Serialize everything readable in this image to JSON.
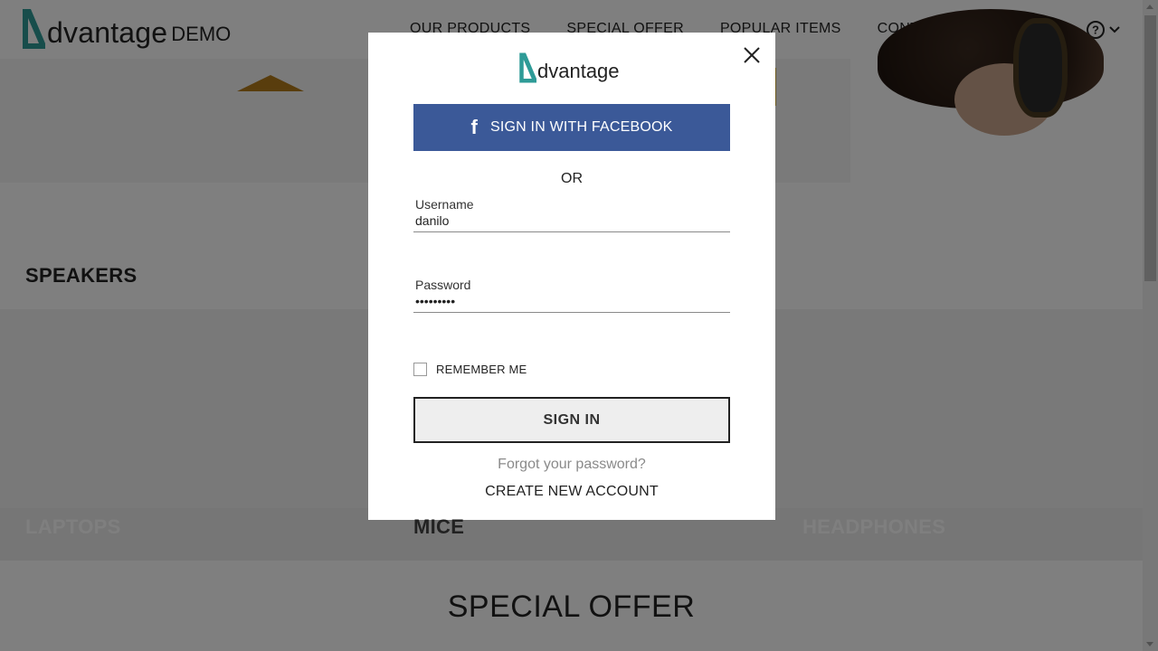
{
  "header": {
    "logo_text": "dvantage",
    "logo_demo": "DEMO",
    "nav": [
      "OUR PRODUCTS",
      "SPECIAL OFFER",
      "POPULAR ITEMS",
      "CONTACT US"
    ],
    "icons": [
      "search-icon",
      "user-icon",
      "cart-icon",
      "help-icon",
      "chevron-down-icon"
    ]
  },
  "categories": {
    "speakers": "SPEAKERS",
    "laptops": "LAPTOPS",
    "mice": "MICE",
    "headphones": "HEADPHONES"
  },
  "special_offer": "SPECIAL OFFER",
  "modal": {
    "logo_text": "dvantage",
    "facebook_button": "SIGN IN WITH FACEBOOK",
    "or": "OR",
    "username_label": "Username",
    "username_value": "danilo",
    "password_label": "Password",
    "password_value": "danilo123",
    "remember_me": "REMEMBER ME",
    "remember_checked": false,
    "sign_in_button": "SIGN IN",
    "forgot_password": "Forgot your password?",
    "create_account": "CREATE NEW ACCOUNT"
  },
  "colors": {
    "brand_teal": "#2e9b97",
    "facebook_blue": "#3b5998",
    "overlay": "rgba(0,0,0,0.5)"
  }
}
